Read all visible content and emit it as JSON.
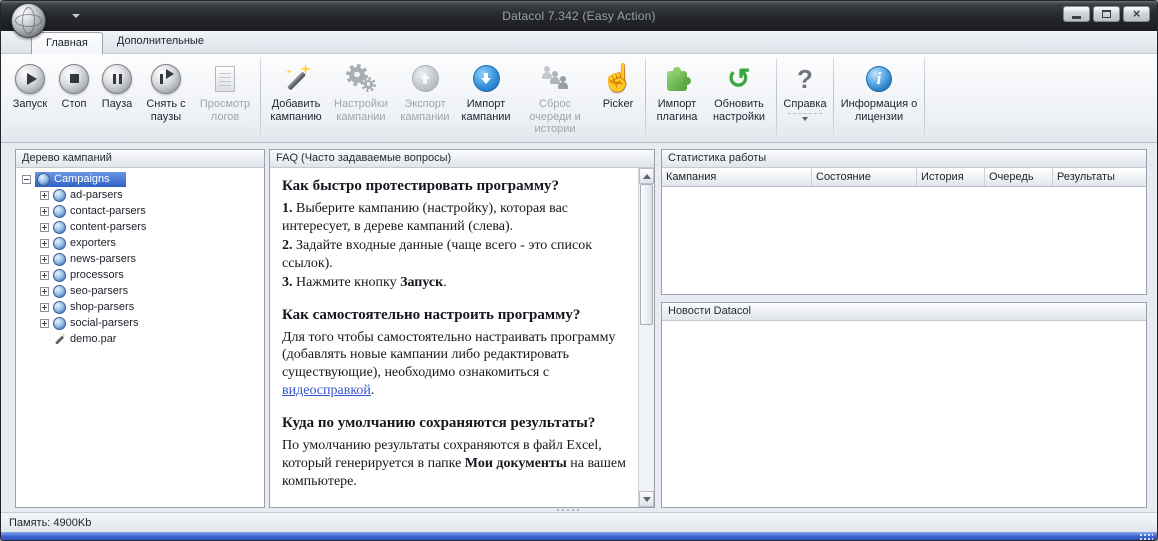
{
  "window": {
    "title": "Datacol 7.342 (Easy Action)",
    "close_glyph": "×"
  },
  "tabs": [
    {
      "label": "Главная",
      "active": true
    },
    {
      "label": "Дополнительные",
      "active": false
    }
  ],
  "toolbar": {
    "buttons": [
      {
        "label": "Запуск",
        "enabled": true
      },
      {
        "label": "Стоп",
        "enabled": true
      },
      {
        "label": "Пауза",
        "enabled": true
      },
      {
        "label": "Снять с паузы",
        "enabled": true
      },
      {
        "label": "Просмотр логов",
        "enabled": false
      },
      {
        "label": "Добавить кампанию",
        "enabled": true
      },
      {
        "label": "Настройки кампании",
        "enabled": false
      },
      {
        "label": "Экспорт кампании",
        "enabled": false
      },
      {
        "label": "Импорт кампании",
        "enabled": true
      },
      {
        "label": "Сброс очереди и истории",
        "enabled": false
      },
      {
        "label": "Picker",
        "enabled": true
      },
      {
        "label": "Импорт плагина",
        "enabled": true
      },
      {
        "label": "Обновить настройки",
        "enabled": true
      },
      {
        "label": "Справка",
        "enabled": true
      },
      {
        "label": "Информация о лицензии",
        "enabled": true
      }
    ]
  },
  "icons": {
    "picker_hand": "☝",
    "refresh_arrow": "↻",
    "question_mark": "?",
    "info_letter": "i"
  },
  "tree": {
    "panel_title": "Дерево кампаний",
    "root_label": "Campaigns",
    "items": [
      "ad-parsers",
      "contact-parsers",
      "content-parsers",
      "exporters",
      "news-parsers",
      "processors",
      "seo-parsers",
      "shop-parsers",
      "social-parsers",
      "demo.par"
    ]
  },
  "faq": {
    "title": "FAQ (Часто задаваемые вопросы)",
    "sections": [
      {
        "heading": "Как быстро протестировать программу?",
        "items": [
          {
            "num": "1.",
            "text": " Выберите кампанию (настройку), которая вас интересует, в дереве кампаний (слева)."
          },
          {
            "num": "2.",
            "text": " Задайте входные данные (чаще всего - это список ссылок)."
          },
          {
            "num": "3.",
            "text_before": " Нажмите кнопку ",
            "bold": "Запуск",
            "text_after": "."
          }
        ]
      },
      {
        "heading": "Как самостоятельно настроить программу?",
        "text_before": "Для того чтобы самостоятельно настраивать программу (добавлять новые кампании либо редактировать существующие), необходимо ознакомиться с ",
        "link": "видеосправкой",
        "text_after": "."
      },
      {
        "heading": "Куда по умолчанию сохраняются результаты?",
        "text_before": "По умолчанию результаты сохраняются в файл Excel, который генерируется в папке ",
        "bold": "Мои документы",
        "text_after": " на вашем компьютере."
      }
    ]
  },
  "stats": {
    "title": "Статистика работы",
    "columns": [
      "Кампания",
      "Состояние",
      "История",
      "Очередь",
      "Результаты"
    ]
  },
  "news": {
    "title": "Новости Datacol"
  },
  "statusbar": {
    "memory": "Память: 4900Kb"
  }
}
